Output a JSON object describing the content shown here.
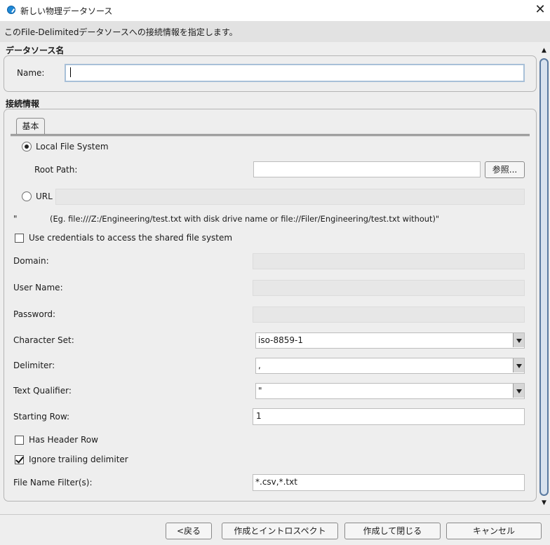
{
  "window": {
    "title": "新しい物理データソース",
    "close_glyph": "✕",
    "icon": "app-icon"
  },
  "info": {
    "text": "このFile-Delimitedデータソースへの接続情報を指定します。"
  },
  "datasource_section": {
    "title": "データソース名",
    "name_label": "Name:",
    "name_value": ""
  },
  "connection_section": {
    "title": "接続情報",
    "tab_basic": "基本",
    "local_fs_label": "Local File System",
    "local_fs_selected": true,
    "root_path_label": "Root Path:",
    "root_path_value": "",
    "browse_button": "参照...",
    "url_label": "URL",
    "url_selected": false,
    "url_value": "",
    "hint_quote": "\"",
    "hint_text": "(Eg. file:///Z:/Engineering/test.txt with disk drive name or file://Filer/Engineering/test.txt without)\"",
    "use_credentials_label": "Use credentials to access the shared file system",
    "use_credentials_checked": false,
    "domain_label": "Domain:",
    "username_label": "User Name:",
    "password_label": "Password:",
    "charset_label": "Character Set:",
    "charset_value": "iso-8859-1",
    "delimiter_label": "Delimiter:",
    "delimiter_value": ",",
    "text_qualifier_label": "Text Qualifier:",
    "text_qualifier_value": "\"",
    "starting_row_label": "Starting Row:",
    "starting_row_value": "1",
    "has_header_label": "Has Header Row",
    "has_header_checked": false,
    "ignore_trailing_label": "Ignore trailing delimiter",
    "ignore_trailing_checked": true,
    "file_filter_label": "File Name Filter(s):",
    "file_filter_value": "*.csv,*.txt"
  },
  "scroll": {
    "up_glyph": "▲",
    "down_glyph": "▼"
  },
  "footer": {
    "back_button": "<戻る",
    "create_introspect_button": "作成とイントロスペクト",
    "create_close_button": "作成して閉じる",
    "cancel_button": "キャンセル"
  }
}
